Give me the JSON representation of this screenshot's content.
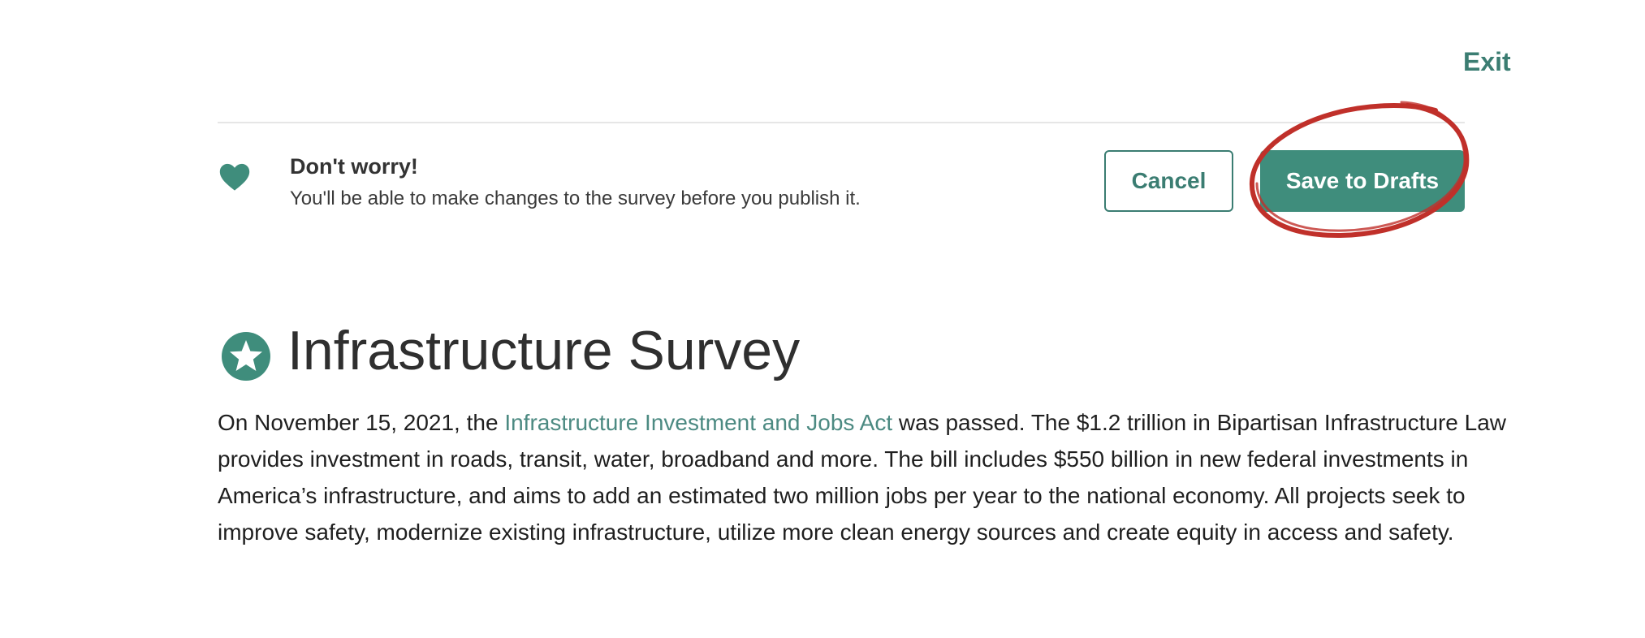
{
  "header": {
    "exit_label": "Exit"
  },
  "notice": {
    "icon": "heart-icon",
    "title": "Don't worry!",
    "text": "You'll be able to make changes to the survey before you publish it."
  },
  "actions": {
    "cancel_label": "Cancel",
    "save_label": "Save to Drafts"
  },
  "survey": {
    "badge_icon": "star-badge-icon",
    "title": "Infrastructure Survey",
    "description": {
      "before_link": "On November 15, 2021, the ",
      "link_text": "Infrastructure Investment and Jobs Act",
      "after_link": " was passed. The $1.2 trillion in Bipartisan Infrastructure Law provides investment in roads, transit, water, broadband and more. The bill includes $550 billion in new federal investments in America’s infrastructure, and aims to add an estimated two million jobs per year to the national economy.  All projects seek to improve safety, modernize existing infrastructure, utilize more clean energy sources and create equity in access and safety."
    }
  },
  "colors": {
    "accent": "#3f8d7c",
    "accent_text": "#3b7d72",
    "link": "#4c8a82",
    "annotation": "#c0302a"
  }
}
